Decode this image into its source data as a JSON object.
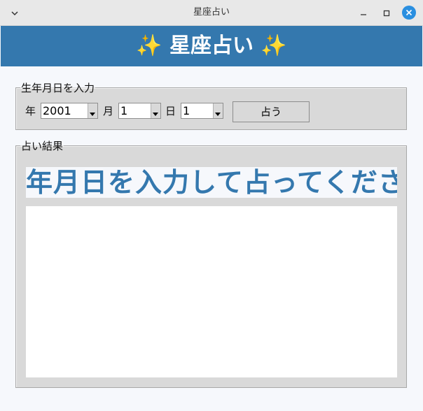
{
  "window": {
    "title": "星座占い"
  },
  "banner": {
    "text": "✨ 星座占い ✨"
  },
  "input_group": {
    "legend": "生年月日を入力",
    "year_label": "年",
    "year_value": "2001",
    "month_label": "月",
    "month_value": "1",
    "day_label": "日",
    "day_value": "1",
    "button_label": "占う"
  },
  "result_group": {
    "legend": "占い結果",
    "headline": "年月日を入力して占ってください",
    "body": ""
  },
  "colors": {
    "accent": "#3478ae",
    "close_button": "#2a8fe0",
    "panel": "#d9d9d9",
    "background": "#f6f8fc"
  },
  "icons": [
    "chevron-down-icon",
    "minimize-icon",
    "maximize-icon",
    "close-icon",
    "dropdown-arrow-icon"
  ]
}
